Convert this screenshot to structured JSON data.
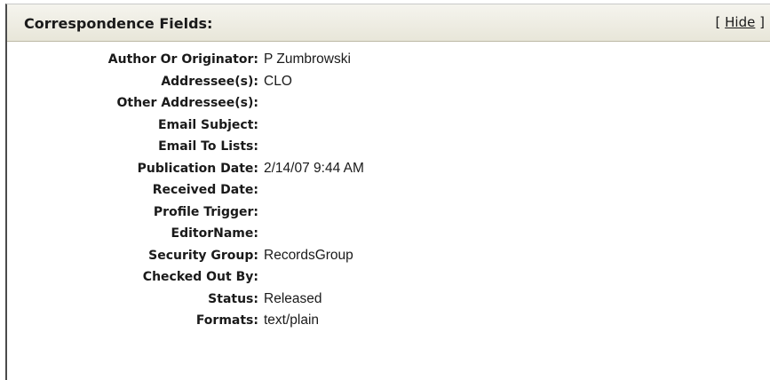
{
  "section": {
    "title": "Correspondence Fields:",
    "toggle_open": "[",
    "toggle_label": "Hide",
    "toggle_close": "]"
  },
  "fields": [
    {
      "label": "Author Or Originator:",
      "value": "P Zumbrowski"
    },
    {
      "label": "Addressee(s):",
      "value": "CLO"
    },
    {
      "label": "Other Addressee(s):",
      "value": ""
    },
    {
      "label": "Email Subject:",
      "value": ""
    },
    {
      "label": "Email To Lists:",
      "value": ""
    },
    {
      "label": "Publication Date:",
      "value": "2/14/07 9:44 AM"
    },
    {
      "label": "Received Date:",
      "value": ""
    },
    {
      "label": "Profile Trigger:",
      "value": ""
    },
    {
      "label": "EditorName:",
      "value": ""
    },
    {
      "label": "Security Group:",
      "value": "RecordsGroup"
    },
    {
      "label": "Checked Out By:",
      "value": ""
    },
    {
      "label": "Status:",
      "value": "Released"
    },
    {
      "label": "Formats:",
      "value": "text/plain"
    }
  ]
}
